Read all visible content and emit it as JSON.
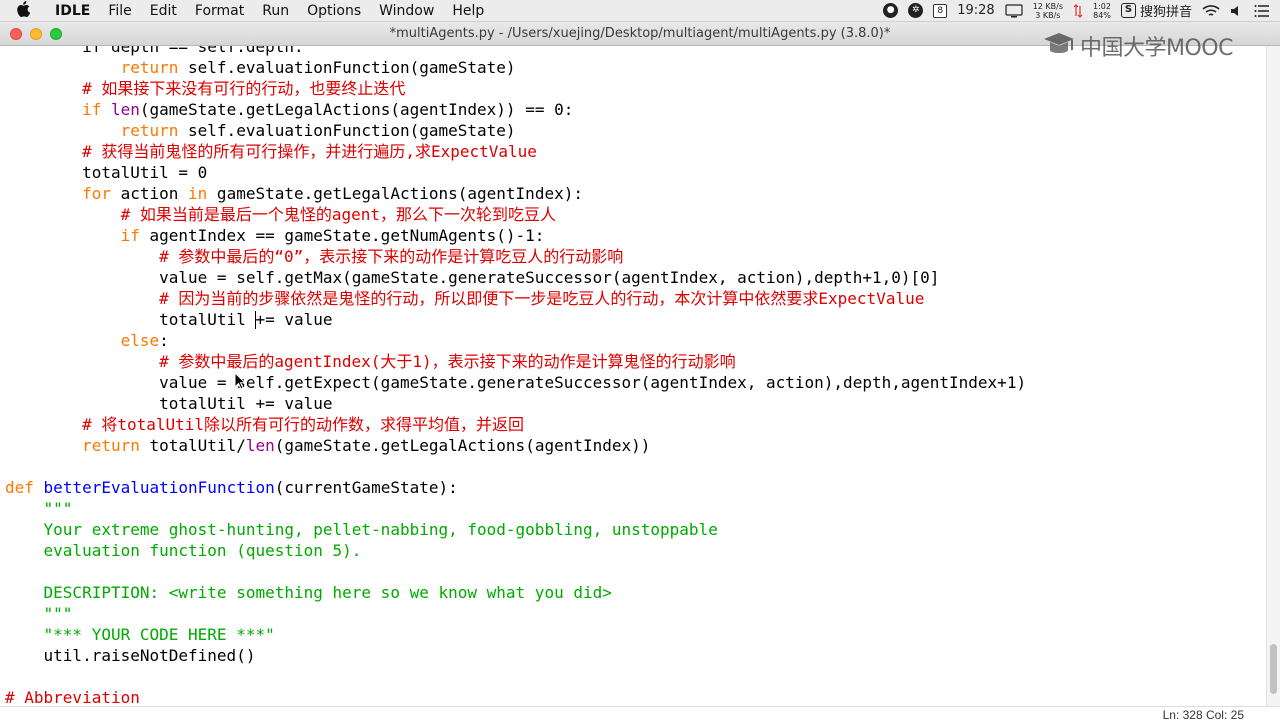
{
  "menubar": {
    "apple_icon": "apple-logo",
    "app_name": "IDLE",
    "menus": [
      "File",
      "Edit",
      "Format",
      "Run",
      "Options",
      "Window",
      "Help"
    ],
    "calendar_day": "8",
    "clock": "19:28",
    "net_up": "12 KB/s",
    "net_down": "3 KB/s",
    "battery_time": "1:02",
    "battery_pct": "84%",
    "input_method": "搜狗拼音"
  },
  "window": {
    "title": "*multiAgents.py - /Users/xuejing/Desktop/multiagent/multiAgents.py (3.8.0)*"
  },
  "watermark": {
    "text": "中国大学MOOC"
  },
  "editor": {
    "lines": [
      [
        {
          "t": "        if depth == self.depth:",
          "c": "kwline"
        }
      ],
      [
        {
          "t": "            ",
          "c": ""
        },
        {
          "t": "return",
          "c": "kw"
        },
        {
          "t": " self.evaluationFunction(gameState)",
          "c": ""
        }
      ],
      [
        {
          "t": "        # 如果接下来没有可行的行动，也要终止迭代",
          "c": "cm"
        }
      ],
      [
        {
          "t": "        ",
          "c": ""
        },
        {
          "t": "if",
          "c": "kw"
        },
        {
          "t": " ",
          "c": ""
        },
        {
          "t": "len",
          "c": "bi"
        },
        {
          "t": "(gameState.getLegalActions(agentIndex)) == 0:",
          "c": ""
        }
      ],
      [
        {
          "t": "            ",
          "c": ""
        },
        {
          "t": "return",
          "c": "kw"
        },
        {
          "t": " self.evaluationFunction(gameState)",
          "c": ""
        }
      ],
      [
        {
          "t": "        # 获得当前鬼怪的所有可行操作，并进行遍历,求ExpectValue",
          "c": "cm"
        }
      ],
      [
        {
          "t": "        totalUtil = 0",
          "c": ""
        }
      ],
      [
        {
          "t": "        ",
          "c": ""
        },
        {
          "t": "for",
          "c": "kw"
        },
        {
          "t": " action ",
          "c": ""
        },
        {
          "t": "in",
          "c": "kw"
        },
        {
          "t": " gameState.getLegalActions(agentIndex):",
          "c": ""
        }
      ],
      [
        {
          "t": "            # 如果当前是最后一个鬼怪的agent，那么下一次轮到吃豆人",
          "c": "cm"
        }
      ],
      [
        {
          "t": "            ",
          "c": ""
        },
        {
          "t": "if",
          "c": "kw"
        },
        {
          "t": " agentIndex == gameState.getNumAgents()-1:",
          "c": ""
        }
      ],
      [
        {
          "t": "                # 参数中最后的“0”，表示接下来的动作是计算吃豆人的行动影响",
          "c": "cm"
        }
      ],
      [
        {
          "t": "                value = self.getMax(gameState.generateSuccessor(agentIndex, action),depth+1,0)[0]",
          "c": ""
        }
      ],
      [
        {
          "t": "                # 因为当前的步骤依然是鬼怪的行动，所以即便下一步是吃豆人的行动，本次计算中依然要求ExpectValue",
          "c": "cm"
        }
      ],
      [
        {
          "t": "                totalUtil += value",
          "c": ""
        }
      ],
      [
        {
          "t": "            ",
          "c": ""
        },
        {
          "t": "else",
          "c": "kw"
        },
        {
          "t": ":",
          "c": ""
        }
      ],
      [
        {
          "t": "                # 参数中最后的agentIndex(大于1)，表示接下来的动作是计算鬼怪的行动影响",
          "c": "cm"
        }
      ],
      [
        {
          "t": "                value = self.getExpect(gameState.generateSuccessor(agentIndex, action),depth,agentIndex+1)",
          "c": ""
        }
      ],
      [
        {
          "t": "                totalUtil += value",
          "c": ""
        }
      ],
      [
        {
          "t": "        # 将totalUtil除以所有可行的动作数，求得平均值，并返回",
          "c": "cm"
        }
      ],
      [
        {
          "t": "        ",
          "c": ""
        },
        {
          "t": "return",
          "c": "kw"
        },
        {
          "t": " totalUtil/",
          "c": ""
        },
        {
          "t": "len",
          "c": "bi"
        },
        {
          "t": "(gameState.getLegalActions(agentIndex))",
          "c": ""
        }
      ],
      [
        {
          "t": "",
          "c": ""
        }
      ],
      [
        {
          "t": "def",
          "c": "kw"
        },
        {
          "t": " ",
          "c": ""
        },
        {
          "t": "betterEvaluationFunction",
          "c": "fn"
        },
        {
          "t": "(currentGameState):",
          "c": ""
        }
      ],
      [
        {
          "t": "    \"\"\"",
          "c": "st"
        }
      ],
      [
        {
          "t": "    Your extreme ghost-hunting, pellet-nabbing, food-gobbling, unstoppable",
          "c": "st"
        }
      ],
      [
        {
          "t": "    evaluation function (question 5).",
          "c": "st"
        }
      ],
      [
        {
          "t": "",
          "c": ""
        }
      ],
      [
        {
          "t": "    DESCRIPTION: <write something here so we know what you did>",
          "c": "st"
        }
      ],
      [
        {
          "t": "    \"\"\"",
          "c": "st"
        }
      ],
      [
        {
          "t": "    \"*** YOUR CODE HERE ***\"",
          "c": "st"
        }
      ],
      [
        {
          "t": "    util.raiseNotDefined()",
          "c": ""
        }
      ],
      [
        {
          "t": "",
          "c": ""
        }
      ],
      [
        {
          "t": "# Abbreviation",
          "c": "cm"
        }
      ]
    ]
  },
  "statusbar": {
    "position": "Ln: 328   Col: 25"
  }
}
